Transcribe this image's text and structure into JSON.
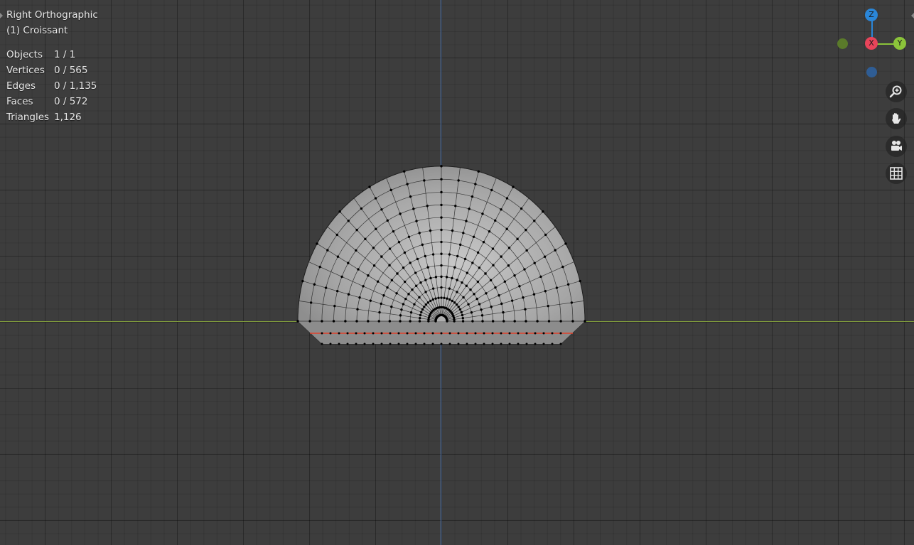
{
  "viewport": {
    "view_name": "Right Orthographic",
    "object_label": "(1) Croissant"
  },
  "stats": [
    {
      "label": "Objects",
      "value": "1 / 1"
    },
    {
      "label": "Vertices",
      "value": "0 / 565"
    },
    {
      "label": "Edges",
      "value": "0 / 1,135"
    },
    {
      "label": "Faces",
      "value": "0 / 572"
    },
    {
      "label": "Triangles",
      "value": "1,126"
    }
  ],
  "gizmo": {
    "z_label": "Z",
    "x_label": "X",
    "y_label": "Y",
    "colors": {
      "x": "#e8445a",
      "y": "#8bc43a",
      "z": "#2a86d8",
      "neg_y": "#5a7a2a",
      "neg_z": "#2f5d94"
    }
  },
  "navigation": [
    {
      "name": "zoom-icon"
    },
    {
      "name": "pan-hand-icon"
    },
    {
      "name": "camera-view-icon"
    },
    {
      "name": "ortho-grid-icon"
    }
  ],
  "colors": {
    "background": "#3d3d3d",
    "mesh_fill": "#a4a4a4",
    "wire": "#1a1a1a",
    "x_axis": "#7f9a3c",
    "y_axis": "#5b86c7",
    "seam": "#e0402a"
  }
}
